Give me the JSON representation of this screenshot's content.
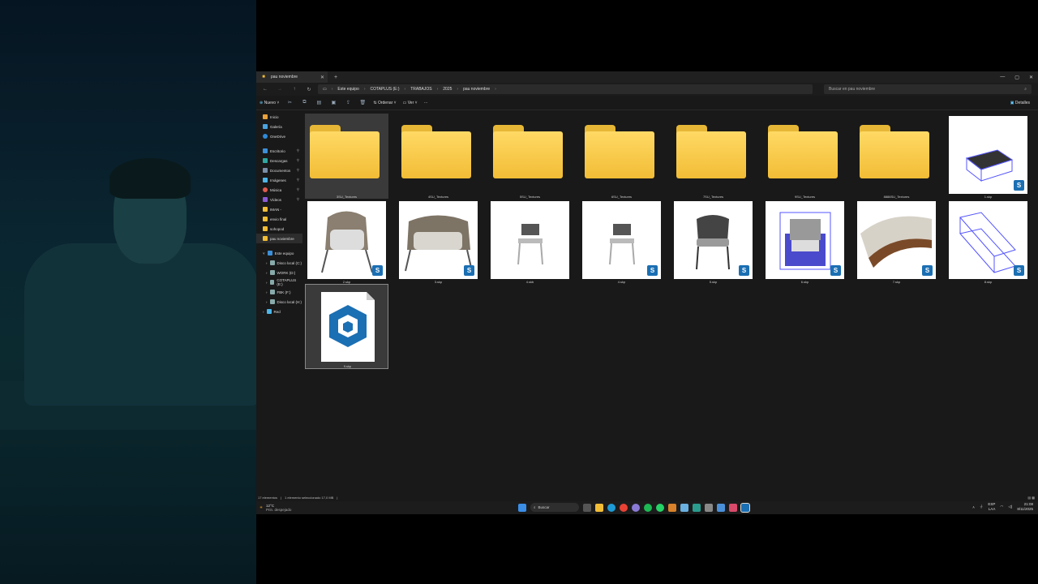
{
  "window": {
    "tab_title": "pau noviembre",
    "new_tab": "+",
    "tab_close": "✕",
    "minimize": "—",
    "maximize": "▢",
    "close": "✕"
  },
  "nav": {
    "back": "←",
    "forward": "→",
    "up": "↑",
    "refresh": "↻"
  },
  "breadcrumbs": [
    "Este equipo",
    "COTAPLUS (E:)",
    "TRABAJOS",
    "2025",
    "pau noviembre"
  ],
  "search": {
    "placeholder": "Buscar en pau noviembre"
  },
  "toolbar": {
    "new_label": "Nuevo",
    "sort_label": "Ordenar",
    "view_label": "Ver",
    "more": "···",
    "details_label": "Detalles"
  },
  "sidebar": {
    "top": [
      "Inicio",
      "Galería",
      "OneDrive"
    ],
    "pinned": [
      "Escritorio",
      "Descargas",
      "Documentos",
      "Imágenes",
      "Música",
      "Vídeos",
      "IMAN -",
      "envio final",
      "sohopod",
      "pau noviembre"
    ],
    "this_pc": "Este equipo",
    "drives": [
      "Disco local (C:)",
      "WORK (D:)",
      "COTAPLUS (E:)",
      "FBK (F:)",
      "Disco local (H:)"
    ],
    "network": "Red"
  },
  "files": [
    {
      "name": "3SU_Textures",
      "kind": "folder"
    },
    {
      "name": "4SU_Textures",
      "kind": "folder"
    },
    {
      "name": "5SU_Textures",
      "kind": "folder"
    },
    {
      "name": "6SU_Textures",
      "kind": "folder"
    },
    {
      "name": "7SU_Textures",
      "kind": "folder"
    },
    {
      "name": "9SU_Textures",
      "kind": "folder"
    },
    {
      "name": "8888SU_Textures",
      "kind": "folder"
    },
    {
      "name": "1.skp",
      "kind": "skp"
    },
    {
      "name": "2.skp",
      "kind": "skp"
    },
    {
      "name": "3.skp",
      "kind": "skp"
    },
    {
      "name": "4.skb",
      "kind": "skb"
    },
    {
      "name": "4.skp",
      "kind": "skp"
    },
    {
      "name": "5.skp",
      "kind": "skp"
    },
    {
      "name": "6.skp",
      "kind": "skp"
    },
    {
      "name": "7.skp",
      "kind": "skp"
    },
    {
      "name": "8.skp",
      "kind": "skp"
    },
    {
      "name": "9.skp",
      "kind": "skp"
    }
  ],
  "status": {
    "count": "17 elementos",
    "selection": "1 elemento seleccionado 17,0 MB"
  },
  "taskbar": {
    "weather_temp": "12°C",
    "weather_desc": "Prin. despejado",
    "search_label": "Buscar",
    "lang_top": "ESP",
    "lang_bottom": "LAA",
    "time": "21:08",
    "date": "8/11/2025"
  },
  "colors": {
    "accent": "#1b6fb3",
    "folder": "#f2bd36",
    "window_bg": "#191919"
  }
}
